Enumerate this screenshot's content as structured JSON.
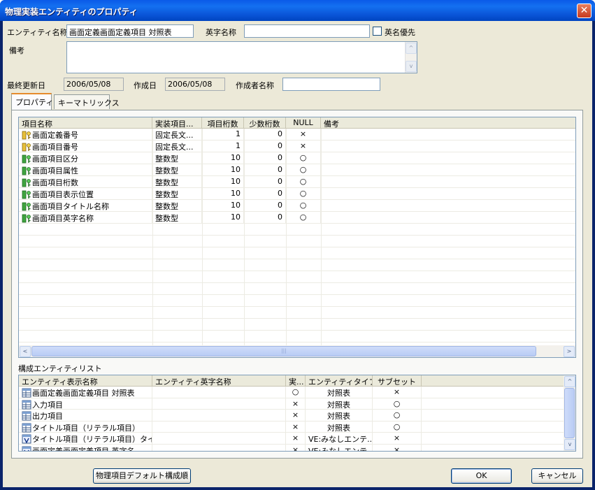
{
  "window": {
    "title": "物理実装エンティティのプロパティ"
  },
  "form": {
    "entity_name_label": "エンティティ名称",
    "entity_name_value": "画面定義画面定義項目 対照表",
    "eng_name_label": "英字名称",
    "eng_name_value": "",
    "eng_priority_label": "英名優先",
    "remarks_label": "備考",
    "remarks_value": "",
    "last_updated_label": "最終更新日",
    "last_updated_value": "2006/05/08",
    "created_label": "作成日",
    "created_value": "2006/05/08",
    "author_label": "作成者名称",
    "author_value": ""
  },
  "tabs": [
    {
      "label": "プロパティ",
      "active": true
    },
    {
      "label": "キーマトリックス",
      "active": false
    }
  ],
  "property_grid": {
    "headers": [
      "項目名称",
      "実装項目...",
      "項目桁数",
      "少数桁数",
      "NULL",
      "備考"
    ],
    "rows": [
      {
        "icon": "key-icon",
        "name": "画面定義番号",
        "type": "固定長文...",
        "digits": "1",
        "decimals": "0",
        "null": "×",
        "note": ""
      },
      {
        "icon": "key-icon",
        "name": "画面項目番号",
        "type": "固定長文...",
        "digits": "1",
        "decimals": "0",
        "null": "×",
        "note": ""
      },
      {
        "icon": "attribute-icon",
        "name": "画面項目区分",
        "type": "整数型",
        "digits": "10",
        "decimals": "0",
        "null": "○",
        "note": ""
      },
      {
        "icon": "attribute-icon",
        "name": "画面項目属性",
        "type": "整数型",
        "digits": "10",
        "decimals": "0",
        "null": "○",
        "note": ""
      },
      {
        "icon": "attribute-icon",
        "name": "画面項目桁数",
        "type": "整数型",
        "digits": "10",
        "decimals": "0",
        "null": "○",
        "note": ""
      },
      {
        "icon": "attribute-icon",
        "name": "画面項目表示位置",
        "type": "整数型",
        "digits": "10",
        "decimals": "0",
        "null": "○",
        "note": ""
      },
      {
        "icon": "attribute-icon",
        "name": "画面項目タイトル名称",
        "type": "整数型",
        "digits": "10",
        "decimals": "0",
        "null": "○",
        "note": ""
      },
      {
        "icon": "attribute-icon",
        "name": "画面項目英字名称",
        "type": "整数型",
        "digits": "10",
        "decimals": "0",
        "null": "○",
        "note": ""
      }
    ]
  },
  "entity_list": {
    "label": "構成エンティティリスト",
    "headers": [
      "エンティティ表示名称",
      "エンティティ英字名称",
      "実...",
      "エンティティタイプ",
      "サブセット"
    ],
    "rows": [
      {
        "icon": "table-icon",
        "name": "画面定義画面定義項目 対照表",
        "eng": "",
        "impl": "○",
        "type": "対照表",
        "subset": "×"
      },
      {
        "icon": "table-icon",
        "name": "入力項目",
        "eng": "",
        "impl": "×",
        "type": "対照表",
        "subset": "○"
      },
      {
        "icon": "table-icon",
        "name": "出力項目",
        "eng": "",
        "impl": "×",
        "type": "対照表",
        "subset": "○"
      },
      {
        "icon": "table-icon",
        "name": "タイトル項目（リテラル項目）",
        "eng": "",
        "impl": "×",
        "type": "対照表",
        "subset": "○"
      },
      {
        "icon": "view-entity-icon",
        "name": "タイトル項目（リテラル項目）タイトル",
        "eng": "",
        "impl": "×",
        "type": "VE:みなしエンテ...",
        "subset": "×"
      },
      {
        "icon": "view-entity-icon",
        "name": "画面定義画面定義項目 英字名",
        "eng": "",
        "impl": "×",
        "type": "VE:みなしエンテ...",
        "subset": "×"
      }
    ]
  },
  "buttons": {
    "default_order": "物理項目デフォルト構成順",
    "ok": "OK",
    "cancel": "キャンセル"
  },
  "scroll_glyphs": {
    "left": "<",
    "right": ">",
    "up": "^",
    "down": "v"
  }
}
